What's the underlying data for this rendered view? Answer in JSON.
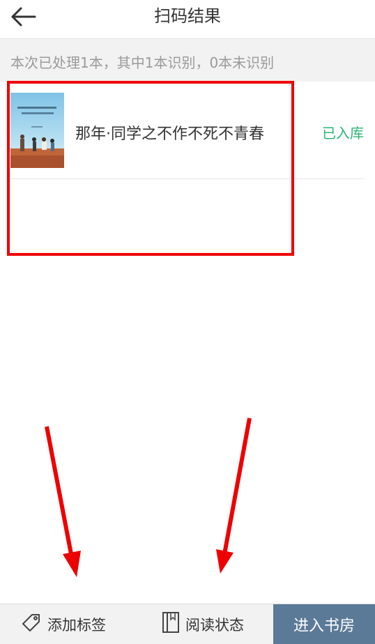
{
  "header": {
    "title": "扫码结果"
  },
  "summary": {
    "text": "本次已处理1本，其中1本识别，0本未识别"
  },
  "books": [
    {
      "title": "那年·同学之不作不死不青春",
      "status": "已入库"
    }
  ],
  "bottom_bar": {
    "add_tag_label": "添加标签",
    "reading_status_label": "阅读状态",
    "enter_library_label": "进入书房"
  },
  "colors": {
    "accent_status": "#2bb673",
    "primary_button": "#5b7a98",
    "annotation_red": "#ee0000"
  }
}
